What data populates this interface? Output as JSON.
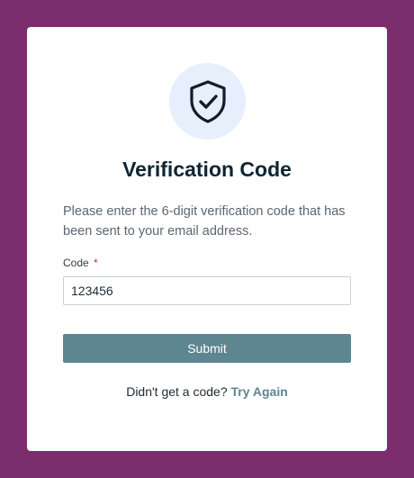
{
  "colors": {
    "page_background": "#7b2d6e",
    "card_background": "#ffffff",
    "icon_circle": "#e6effb",
    "title": "#0f2533",
    "accent": "#5d8690",
    "required": "#d32f2f"
  },
  "header": {
    "icon": "shield-check-icon",
    "title": "Verification Code"
  },
  "form": {
    "description": "Please enter the 6-digit verification code that has been sent to your email address.",
    "code_label": "Code",
    "required_marker": "*",
    "code_value": "123456",
    "submit_label": "Submit"
  },
  "footer": {
    "prompt": "Didn't get a code?",
    "link_label": "Try Again"
  }
}
